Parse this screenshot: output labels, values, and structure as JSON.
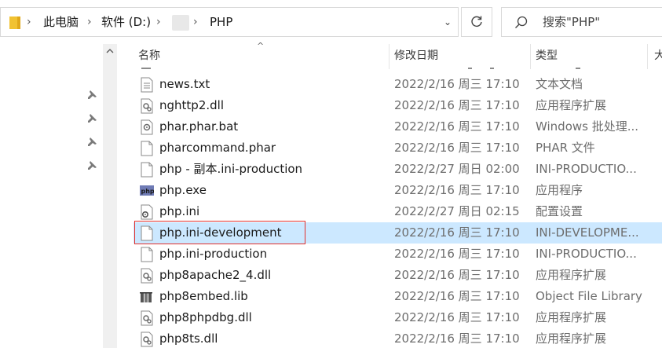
{
  "address_bar": {
    "crumbs": [
      "此电脑",
      "软件 (D:)",
      "PHP"
    ]
  },
  "search": {
    "placeholder": "搜索\"PHP\""
  },
  "columns": {
    "name": "名称",
    "modified": "修改日期",
    "type": "类型",
    "size": "大"
  },
  "files": [
    {
      "name": "news.txt",
      "date": "2022/2/16 周三 17:10",
      "type": "文本文档",
      "icon": "text-file-icon"
    },
    {
      "name": "nghttp2.dll",
      "date": "2022/2/16 周三 17:10",
      "type": "应用程序扩展",
      "icon": "dll-file-icon"
    },
    {
      "name": "phar.phar.bat",
      "date": "2022/2/16 周三 17:10",
      "type": "Windows 批处理...",
      "icon": "batch-file-icon"
    },
    {
      "name": "pharcommand.phar",
      "date": "2022/2/16 周三 17:10",
      "type": "PHAR 文件",
      "icon": "blank-file-icon"
    },
    {
      "name": "php - 副本.ini-production",
      "date": "2022/2/27 周日 02:00",
      "type": "INI-PRODUCTIO...",
      "icon": "blank-file-icon"
    },
    {
      "name": "php.exe",
      "date": "2022/2/16 周三 17:10",
      "type": "应用程序",
      "icon": "php-exe-icon"
    },
    {
      "name": "php.ini",
      "date": "2022/2/27 周日 02:15",
      "type": "配置设置",
      "icon": "ini-settings-icon"
    },
    {
      "name": "php.ini-development",
      "date": "2022/2/16 周三 17:10",
      "type": "INI-DEVELOPME...",
      "icon": "blank-file-icon",
      "selected": true
    },
    {
      "name": "php.ini-production",
      "date": "2022/2/16 周三 17:10",
      "type": "INI-PRODUCTIO...",
      "icon": "blank-file-icon"
    },
    {
      "name": "php8apache2_4.dll",
      "date": "2022/2/16 周三 17:10",
      "type": "应用程序扩展",
      "icon": "dll-file-icon"
    },
    {
      "name": "php8embed.lib",
      "date": "2022/2/16 周三 17:10",
      "type": "Object File Library",
      "icon": "lib-file-icon"
    },
    {
      "name": "php8phpdbg.dll",
      "date": "2022/2/16 周三 17:10",
      "type": "应用程序扩展",
      "icon": "dll-file-icon"
    },
    {
      "name": "php8ts.dll",
      "date": "2022/2/16 周三 17:10",
      "type": "应用程序扩展",
      "icon": "dll-file-icon"
    }
  ],
  "colors": {
    "selection": "#cce8ff",
    "highlight_outline": "#e2312d",
    "folder": "#f1c232"
  }
}
